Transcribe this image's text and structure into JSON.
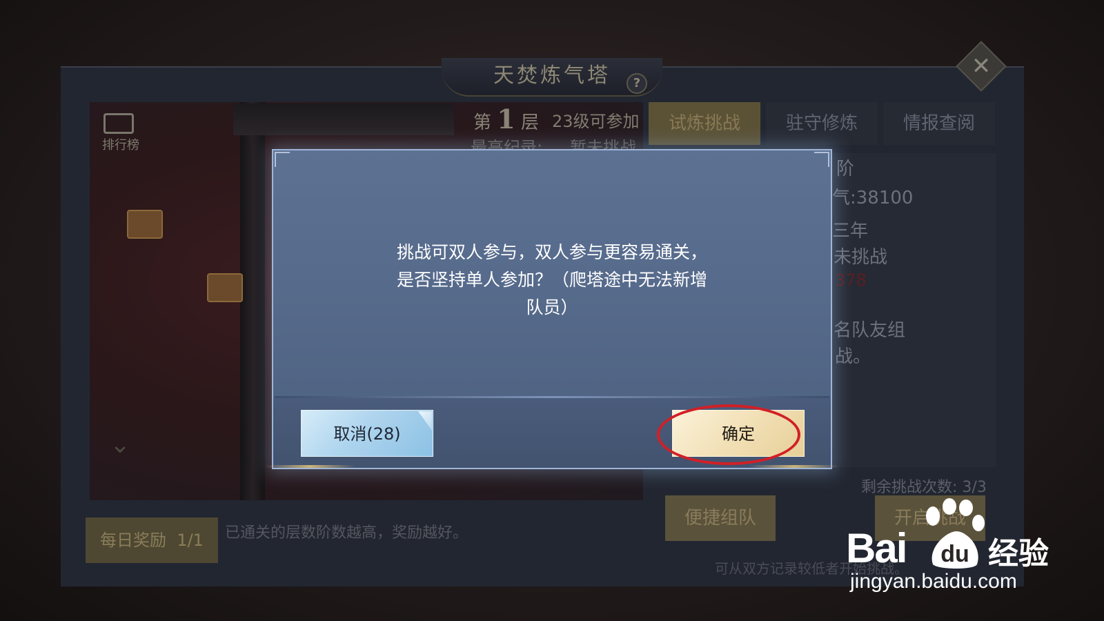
{
  "panel": {
    "title": "天焚炼气塔",
    "help": "?",
    "close": "✕",
    "rank_label": "排行榜",
    "floor": {
      "prefix": "第",
      "number": "1",
      "suffix": "层",
      "requirement": "23级可参加"
    },
    "record": {
      "label": "最高纪录:",
      "value": "暂未挑战"
    },
    "tabs": [
      "试炼挑战",
      "驻守修炼",
      "情报查阅"
    ],
    "right_info": [
      "阶",
      "气:38100",
      "三年",
      "未挑战",
      "378",
      "名队友组",
      "战。"
    ],
    "remaining": "剩余挑战次数: 3/3",
    "team_button": "便捷组队",
    "start_button": "开启挑战",
    "bottom_note": "可从双方记录较低者开始挑战。",
    "daily_reward": {
      "label": "每日奖励",
      "count": "1/1"
    },
    "daily_hint": "已通关的层数阶数越高，奖励越好。"
  },
  "dialog": {
    "message_lines": [
      "挑战可双人参与，双人参与更容易通关，",
      "是否坚持单人参加？（爬塔途中无法新增",
      "队员）"
    ],
    "cancel_label": "取消(28)",
    "confirm_label": "确定"
  },
  "watermark": {
    "bai": "Bai",
    "du": "du",
    "jingyan": "经验",
    "url": "jingyan.baidu.com"
  },
  "colors": {
    "dialog_bg": "#566a8b",
    "cancel_btn": "#aed4ee",
    "confirm_btn": "#f2e0b6",
    "highlight": "#d21f26"
  }
}
